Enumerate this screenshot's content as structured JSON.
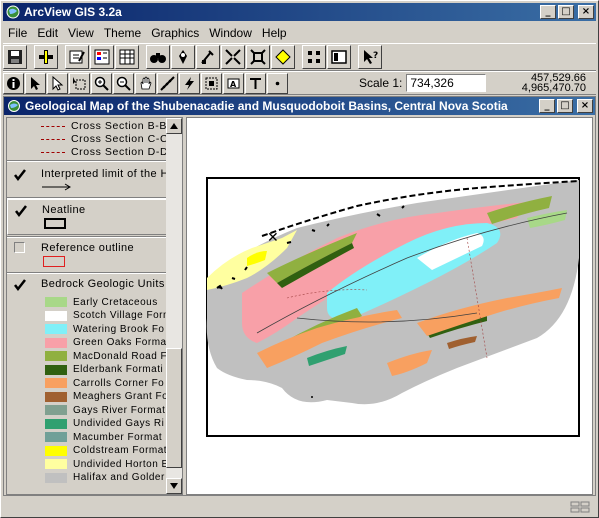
{
  "app": {
    "title": "ArcView GIS 3.2a",
    "controls": {
      "minimize": "_",
      "maximize": "□",
      "close": "×"
    }
  },
  "menu": [
    "File",
    "Edit",
    "View",
    "Theme",
    "Graphics",
    "Window",
    "Help"
  ],
  "toolbar": {
    "scale_label": "Scale 1:",
    "scale_value": "734,326",
    "coord_x": "457,529.66",
    "coord_y": "4,965,470.70"
  },
  "view": {
    "title": "Geological Map of the Shubenacadie and Musquodoboit Basins, Central Nova Scotia"
  },
  "toc": {
    "cross_sections": [
      "Cross Section B-B'",
      "Cross Section C-C'",
      "Cross Section D-D'"
    ],
    "interpreted": "Interpreted limit of the Ho",
    "neatline": "Neatline",
    "reference": "Reference outline",
    "bedrock": "Bedrock Geologic Units",
    "legend": [
      {
        "label": "Early Cretaceous",
        "color": "#a8d888"
      },
      {
        "label": "Scotch Village Form",
        "color": "#ffffff"
      },
      {
        "label": "Watering Brook Fo",
        "color": "#80f0f8"
      },
      {
        "label": "Green Oaks Forma",
        "color": "#f8a0a8"
      },
      {
        "label": "MacDonald Road F",
        "color": "#90b040"
      },
      {
        "label": "Elderbank Formati",
        "color": "#306010"
      },
      {
        "label": "Carrolls Corner Fo",
        "color": "#f8a060"
      },
      {
        "label": "Meaghers Grant Fo",
        "color": "#a06030"
      },
      {
        "label": "Gays River Format",
        "color": "#80a090"
      },
      {
        "label": "Undivided Gays Ri",
        "color": "#30a070"
      },
      {
        "label": "Macumber Format",
        "color": "#70a098"
      },
      {
        "label": "Coldstream Format",
        "color": "#ffff00"
      },
      {
        "label": "Undivided Horton E",
        "color": "#ffffa0"
      },
      {
        "label": "Halifax and Golder",
        "color": "#c0c0c0"
      }
    ]
  }
}
